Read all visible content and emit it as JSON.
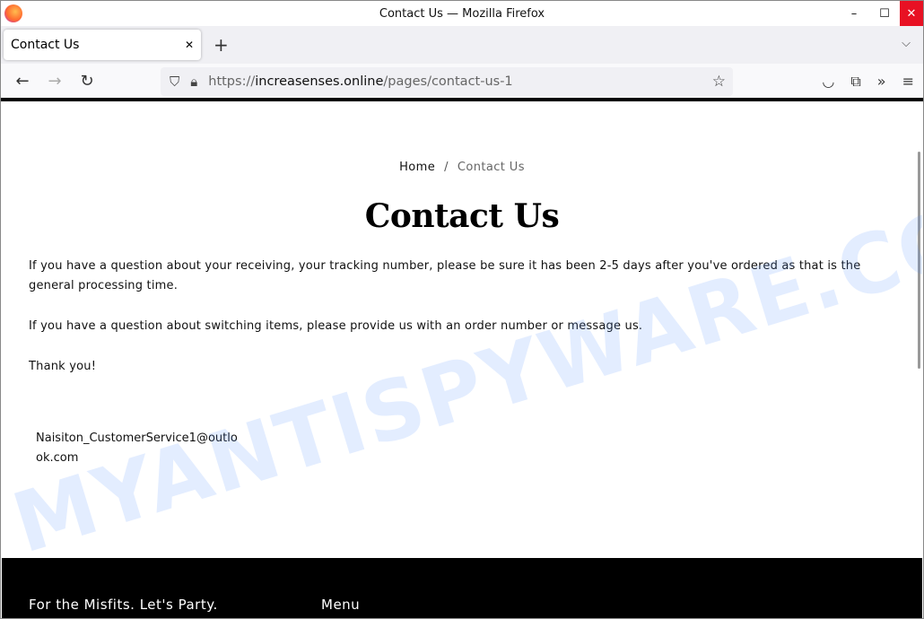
{
  "window": {
    "title": "Contact Us — Mozilla Firefox",
    "minimize": "–",
    "maximize": "☐",
    "close": "✕"
  },
  "tabs": [
    {
      "label": "Contact Us",
      "close": "✕"
    }
  ],
  "toolbar": {
    "new_tab": "+",
    "tab_list": "⌵",
    "back": "←",
    "forward": "→",
    "reload": "↻",
    "url": {
      "scheme": "https://",
      "host": "increasenses.online",
      "path": "/pages/contact-us-1"
    }
  },
  "page": {
    "breadcrumb": {
      "home": "Home",
      "separator": "/",
      "current": "Contact Us"
    },
    "title": "Contact Us",
    "paragraphs": [
      "If you have a question about your receiving, your tracking number, please be sure it has been 2-5 days after you've ordered as that is the general processing time.",
      "If you have a question about switching items, please provide us with an order number or message us.",
      "Thank you!"
    ],
    "email": "Naisiton_CustomerService1@outlook.com"
  },
  "footer": {
    "tagline": "For the Misfits. Let's Party.",
    "menu_heading": "Menu"
  },
  "watermark": "MYANTISPYWARE.COM"
}
